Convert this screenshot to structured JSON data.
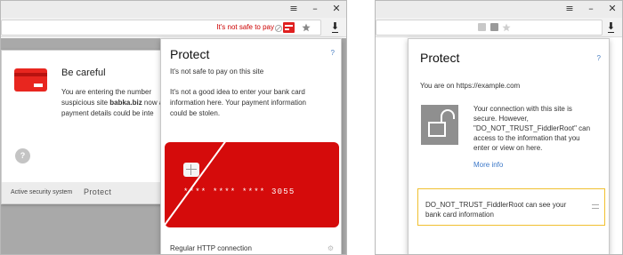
{
  "left": {
    "window_controls": [
      "≡",
      "–",
      "✕"
    ],
    "address_warning": "It's not safe to pay",
    "icons": [
      "lock-broken-icon",
      "card-warning-icon",
      "star-icon",
      "download-icon"
    ],
    "warning_dialog": {
      "title": "Be careful",
      "body_lines": [
        "You are entering the number",
        "suspicious site ",
        "payment details could be inte"
      ],
      "site": "babka.biz",
      "body_line2_suffix": " now an",
      "help": "?",
      "footer_small": "Active security system",
      "footer_brand": "Protect"
    },
    "popup": {
      "title": "Protect",
      "help": "?",
      "status": "It's not safe to pay on this site",
      "details": [
        "It's not a good idea to enter your bank card",
        "information here. Your payment information",
        "could be stolen."
      ],
      "card_number": "**** **** **** 3055",
      "connection": "Regular HTTP connection"
    }
  },
  "right": {
    "window_controls": [
      "≡",
      "–",
      "✕"
    ],
    "popup": {
      "title": "Protect",
      "help": "?",
      "location": "You are on https://example.com",
      "connection_lines": [
        "Your connection with this site is",
        "secure. However,",
        "\"DO_NOT_TRUST_FiddlerRoot\" can",
        "access to the information that you",
        "enter or view on here."
      ],
      "more_info": "More info",
      "trust_lines": [
        "DO_NOT_TRUST_FiddlerRoot can see your",
        "bank card information"
      ]
    }
  },
  "colors": {
    "danger_red": "#d50b0b",
    "warning_yellow": "#f0c030",
    "link_blue": "#3c78c8"
  }
}
